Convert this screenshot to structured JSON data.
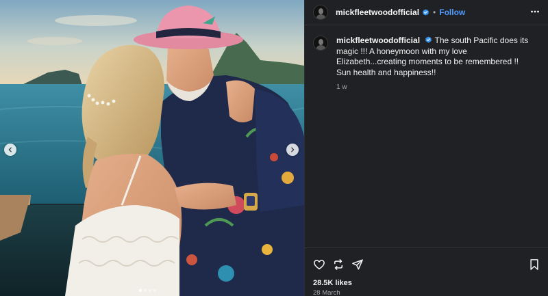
{
  "post": {
    "username": "mickfleetwoodofficial",
    "follow_label": "Follow",
    "separator": "•",
    "caption": "The south Pacific does its magic !!! A honeymoon with my love Elizabeth...creating moments to be remembered !! Sun health and happiness!!",
    "time_ago": "1 w",
    "likes": "28.5K likes",
    "date": "28 March"
  },
  "carousel": {
    "slide_count": 4,
    "active_slide": 1
  },
  "icons": {
    "verified": "verified-badge-icon",
    "more": "more-options-icon",
    "prev": "chevron-left-icon",
    "next": "chevron-right-icon",
    "like": "heart-icon",
    "repost": "repost-icon",
    "share": "share-icon",
    "save": "bookmark-icon"
  },
  "colors": {
    "accent": "#4f9bff",
    "panel": "#202125",
    "verified": "#3897f0"
  }
}
